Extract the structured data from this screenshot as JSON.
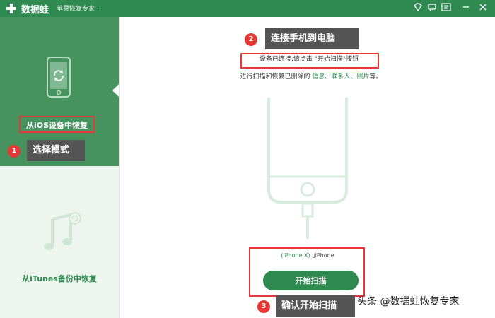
{
  "app": {
    "brand": "数据蛙",
    "product": "苹果恢复专家 ·"
  },
  "titlebar": {
    "icons": [
      "diamond-icon",
      "feedback-icon",
      "menu-icon",
      "minimize-icon",
      "close-icon"
    ]
  },
  "sidebar": {
    "modes": [
      {
        "label": "从iOS设备中恢复",
        "icon": "phone-restore-icon",
        "selected": true
      },
      {
        "label": "从iTunes备份中恢复",
        "icon": "music-restore-icon",
        "selected": false
      }
    ]
  },
  "main": {
    "hint_line1": "设备已连接,请点击 \"开始扫描\"按钮",
    "hint_line2_prefix": "进行扫描和恢复已删除的 ",
    "hint_line2_items": [
      "信息",
      "联系人",
      "照片"
    ],
    "hint_line2_suffix": "等。",
    "device_model": "(iPhone X)",
    "device_name": "iPhone",
    "start_button": "开始扫描"
  },
  "annotations": [
    {
      "number": "1",
      "text": "选择模式"
    },
    {
      "number": "2",
      "text": "连接手机到电脑"
    },
    {
      "number": "3",
      "text": "确认开始扫描"
    }
  ],
  "watermark": "头条 @数据蛙恢复专家",
  "colors": {
    "accent": "#2f8a51",
    "annotation_red": "#e53935"
  }
}
